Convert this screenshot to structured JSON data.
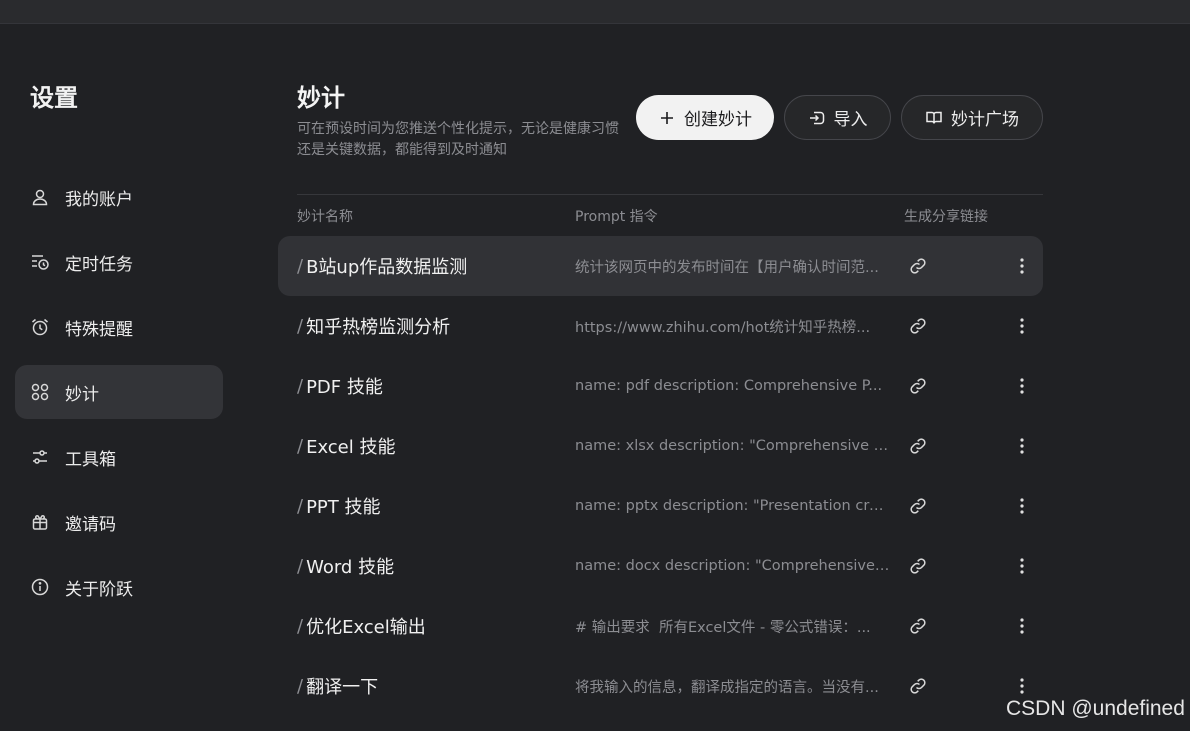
{
  "sidebar": {
    "title": "设置",
    "items": [
      {
        "label": "我的账户",
        "icon": "user-icon"
      },
      {
        "label": "定时任务",
        "icon": "scheduled-task-icon"
      },
      {
        "label": "特殊提醒",
        "icon": "alarm-clock-icon"
      },
      {
        "label": "妙计",
        "icon": "grid-apps-icon",
        "active": true
      },
      {
        "label": "工具箱",
        "icon": "sliders-icon"
      },
      {
        "label": "邀请码",
        "icon": "gift-icon"
      },
      {
        "label": "关于阶跃",
        "icon": "info-icon"
      }
    ]
  },
  "main": {
    "title": "妙计",
    "description": "可在预设时间为您推送个性化提示，无论是健康习惯还是关键数据，都能得到及时通知",
    "buttons": {
      "create": "创建妙计",
      "import": "导入",
      "plaza": "妙计广场"
    },
    "columns": {
      "name": "妙计名称",
      "prompt": "Prompt 指令",
      "share": "生成分享链接"
    },
    "rows": [
      {
        "name": "B站up作品数据监测",
        "prompt": "统计该网页中的发布时间在【用户确认时间范..."
      },
      {
        "name": "知乎热榜监测分析",
        "prompt": "https://www.zhihu.com/hot统计知乎热榜..."
      },
      {
        "name": "PDF 技能",
        "prompt": "name: pdf description: Comprehensive P..."
      },
      {
        "name": "Excel 技能",
        "prompt": "name: xlsx description: \"Comprehensive s..."
      },
      {
        "name": "PPT 技能",
        "prompt": "name: pptx description: \"Presentation cre..."
      },
      {
        "name": "Word 技能",
        "prompt": "name: docx description: \"Comprehensive ..."
      },
      {
        "name": "优化Excel输出",
        "prompt": "# 输出要求 ￼ 所有Excel文件 - 零公式错误：..."
      },
      {
        "name": "翻译一下",
        "prompt": "将我输入的信息，翻译成指定的语言。当没有..."
      }
    ]
  },
  "watermark": "CSDN @undefined"
}
